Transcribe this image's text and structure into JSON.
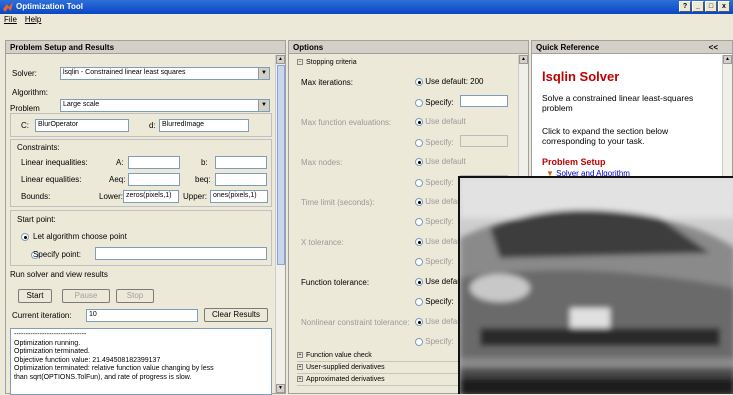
{
  "window": {
    "title": "Optimization Tool",
    "controls": [
      "?",
      "_",
      "□",
      "x"
    ]
  },
  "menu": [
    {
      "label": "File"
    },
    {
      "label": "Help"
    }
  ],
  "left": {
    "header": "Problem Setup and Results",
    "solver_label": "Solver:",
    "solver_value": "lsqlin - Constrained linear least squares",
    "algorithm_label": "Algorithm:",
    "algorithm_value": "Large scale",
    "problem_title": "Problem",
    "c_label": "C:",
    "c_value": "BlurOperator",
    "d_label": "d:",
    "d_value": "BlurredImage",
    "constraints_title": "Constraints:",
    "lin_ineq_label": "Linear inequalities:",
    "a_label": "A:",
    "b_label": "b:",
    "lin_eq_label": "Linear equalities:",
    "aeq_label": "Aeq:",
    "beq_label": "beq:",
    "bounds_label": "Bounds:",
    "lower_label": "Lower:",
    "lower_value": "zeros(pixels,1)",
    "upper_label": "Upper:",
    "upper_value": "ones(pixels,1)",
    "start_point_title": "Start point:",
    "let_algo_label": "Let algorithm choose point",
    "specify_point_label": "Specify point:",
    "run_title": "Run solver and view results",
    "start_btn": "Start",
    "pause_btn": "Pause",
    "stop_btn": "Stop",
    "current_iter_label": "Current iteration:",
    "current_iter_value": "10",
    "clear_btn": "Clear Results",
    "output_lines": [
      "-------------------------------",
      "Optimization running.",
      "Optimization terminated.",
      "Objective function value: 21.494508182399137",
      "Optimization terminated: relative function value changing by less",
      " than sqrt(OPTIONS.TolFun), and rate of progress is slow."
    ]
  },
  "middle": {
    "header": "Options",
    "stopping_title": "Stopping criteria",
    "max_iter_label": "Max iterations:",
    "use_default_200": "Use default: 200",
    "specify": "Specify:",
    "max_fev_label": "Max function evaluations:",
    "use_default": "Use default",
    "max_nodes_label": "Max nodes:",
    "time_limit_label": "Time limit (seconds):",
    "x_tol_label": "X tolerance:",
    "use_defau": "Use defau",
    "fun_tol_label": "Function tolerance:",
    "nonlin_tol_label": "Nonlinear constraint tolerance:",
    "sections": [
      "Function value check",
      "User-supplied derivatives",
      "Approximated derivatives"
    ]
  },
  "right": {
    "header": "Quick Reference",
    "collapse": "<<",
    "title": "lsqlin Solver",
    "desc": "Solve a constrained linear least-squares problem",
    "hint": "Click to expand the section below corresponding to your task.",
    "problem_setup": "Problem Setup",
    "link": "Solver and Algorithm"
  }
}
